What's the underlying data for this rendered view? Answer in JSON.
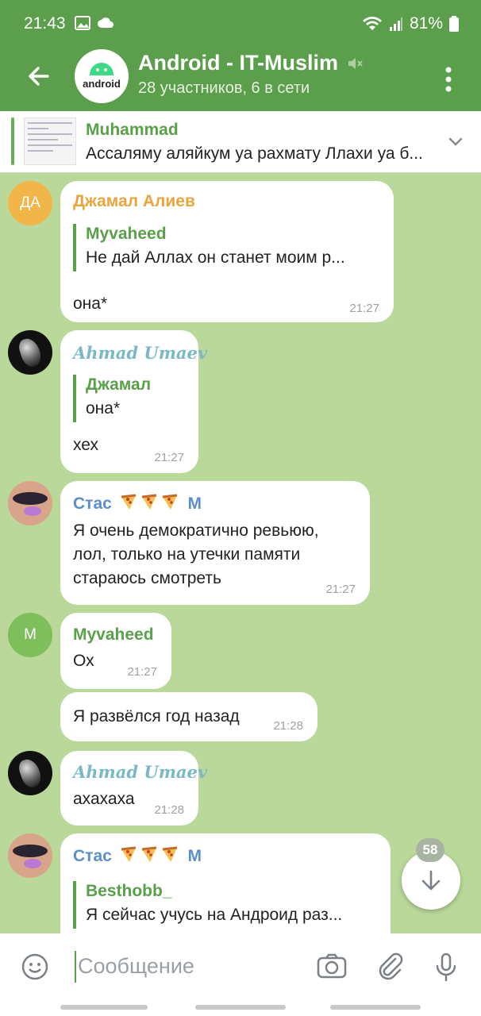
{
  "status": {
    "time": "21:43",
    "battery": "81%"
  },
  "header": {
    "title": "Android - IT-Muslim",
    "subtitle": "28 участников, 6 в сети",
    "avatar_word": "android"
  },
  "pinned": {
    "name": "Muhammad",
    "text": "Ассаляму аляйкум уа рахмату Ллахи уа б..."
  },
  "messages": [
    {
      "sender": "Джамал Алиев",
      "avatar_initials": "ДА",
      "reply_name": "Myvaheed",
      "reply_text": "Не дай Аллах он станет моим р...",
      "text": "она*",
      "time": "21:27"
    },
    {
      "sender": "Ahmad Umaev",
      "reply_name": "Джамал",
      "reply_text": "она*",
      "text": "хех",
      "time": "21:27"
    },
    {
      "sender": "Стас",
      "sender_suffix": "M",
      "text_lines": [
        "Я очень демократично ревьюю,",
        "лол, только на утечки памяти",
        "стараюсь смотреть"
      ],
      "time": "21:27"
    },
    {
      "sender": "Myvaheed",
      "avatar_initials": "M",
      "text": "Ох",
      "time": "21:27"
    },
    {
      "text": "Я развёлся год назад",
      "time": "21:28"
    },
    {
      "sender": "Ahmad Umaev",
      "text": "ахахаха",
      "time": "21:28"
    },
    {
      "sender": "Стас",
      "sender_suffix": "M",
      "reply_name": "Besthobb_",
      "reply_text": "Я сейчас учусь на Андроид раз..."
    }
  ],
  "scroll_badge": "58",
  "input": {
    "placeholder": "Сообщение"
  },
  "colors": {
    "header": "#5b9e4c",
    "accent_green": "#5aa04a",
    "chat_bg": "#b9d89a",
    "name_orange": "#e9a53d",
    "name_teal": "#7ab8c6",
    "name_blue": "#5b8fc7"
  }
}
